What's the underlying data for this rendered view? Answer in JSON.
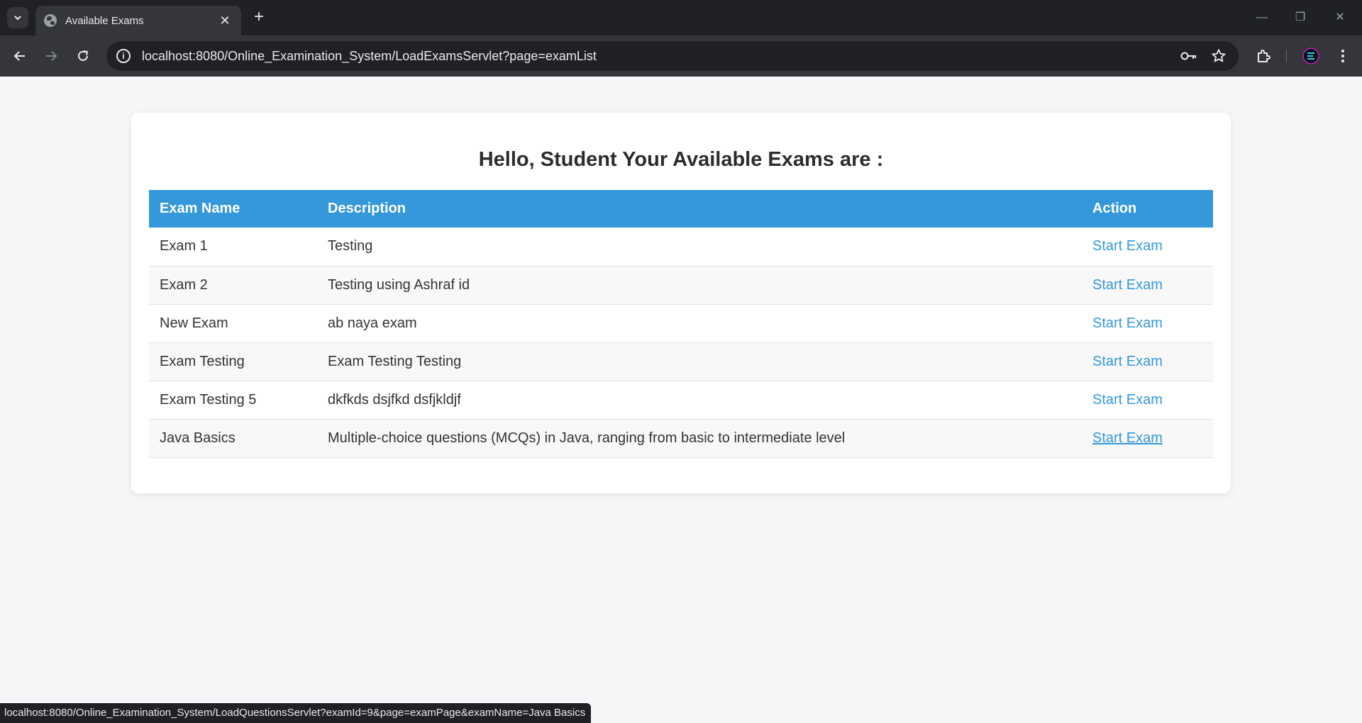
{
  "browser": {
    "tab_title": "Available Exams",
    "url": "localhost:8080/Online_Examination_System/LoadExamsServlet?page=examList",
    "status_url": "localhost:8080/Online_Examination_System/LoadQuestionsServlet?examId=9&page=examPage&examName=Java Basics"
  },
  "page": {
    "heading": "Hello, Student Your Available Exams are :",
    "columns": {
      "name": "Exam Name",
      "description": "Description",
      "action": "Action"
    },
    "exams": [
      {
        "name": "Exam 1",
        "description": "Testing",
        "action": "Start Exam"
      },
      {
        "name": "Exam 2",
        "description": "Testing using Ashraf id",
        "action": "Start Exam"
      },
      {
        "name": "New Exam",
        "description": "ab naya exam",
        "action": "Start Exam"
      },
      {
        "name": "Exam Testing",
        "description": "Exam Testing Testing",
        "action": "Start Exam"
      },
      {
        "name": "Exam Testing 5",
        "description": "dkfkds dsjfkd dsfjkldjf",
        "action": "Start Exam"
      },
      {
        "name": "Java Basics",
        "description": "Multiple-choice questions (MCQs) in Java, ranging from basic to intermediate level",
        "action": "Start Exam"
      }
    ]
  },
  "colors": {
    "header_bg": "#3498db",
    "link": "#3498db",
    "page_bg": "#f5f6f8"
  }
}
